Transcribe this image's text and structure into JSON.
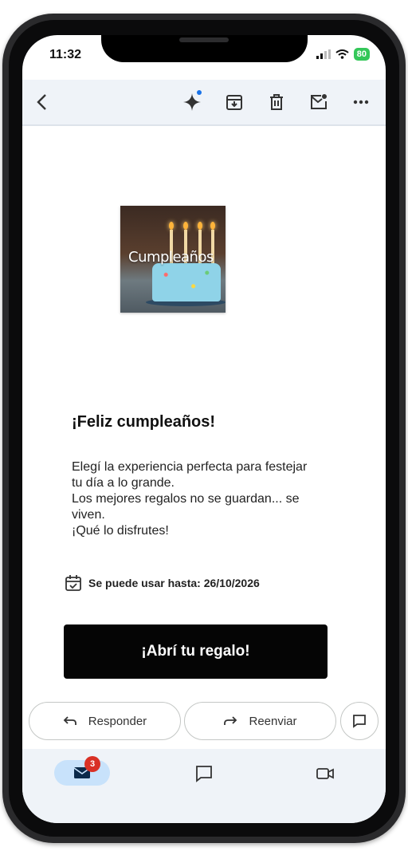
{
  "status_bar": {
    "time": "11:32",
    "battery": "80"
  },
  "toolbar": {
    "icons": [
      "back-arrow-icon",
      "sparkle-icon",
      "archive-icon",
      "trash-icon",
      "mark-unread-icon",
      "more-icon"
    ]
  },
  "hero": {
    "image_text": "Cumpleaños"
  },
  "email": {
    "title": "¡Feliz cumpleaños!",
    "body": [
      "Elegí la experiencia perfecta para festejar",
      "tu día a lo grande.",
      "Los mejores regalos no se guardan... se",
      "viven.",
      "¡Qué lo disfrutes!"
    ],
    "validity": "Se puede usar hasta: 26/10/2026",
    "cta": "¡Abrí tu regalo!"
  },
  "actions": {
    "reply": "Responder",
    "forward": "Reenviar"
  },
  "bottom_nav": {
    "mail_badge": "3"
  },
  "colors": {
    "accent": "#1a73e8",
    "badge": "#d93025",
    "cta": "#050505",
    "nav_active": "#c8e2fb",
    "battery": "#34c759"
  }
}
